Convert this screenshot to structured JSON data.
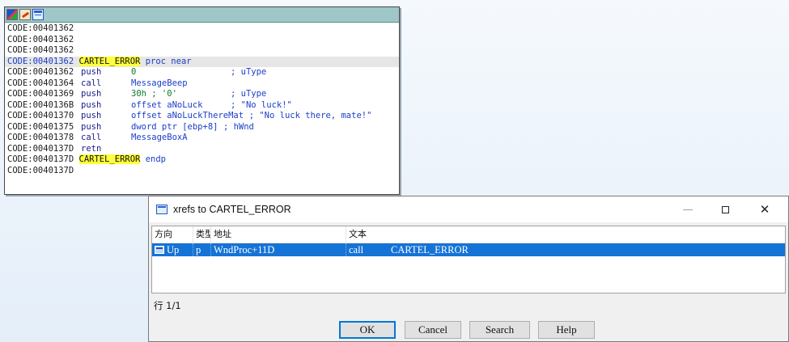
{
  "ida": {
    "lines": [
      {
        "addr": "CODE:00401362",
        "addr_blue": false,
        "sel": false
      },
      {
        "addr": "CODE:00401362",
        "addr_blue": false,
        "sel": false
      },
      {
        "addr": "CODE:00401362",
        "addr_blue": false,
        "sel": false
      },
      {
        "addr": "CODE:00401362",
        "addr_blue": true,
        "sel": true,
        "label": "CARTEL_ERROR",
        "rest": " proc near"
      },
      {
        "addr": "CODE:00401362",
        "mnem": "push",
        "operand": "0",
        "comment": "; uType"
      },
      {
        "addr": "CODE:00401364",
        "mnem": "call",
        "operand": "MessageBeep",
        "comment": ""
      },
      {
        "addr": "CODE:00401369",
        "mnem": "push",
        "operand": "30h ; '0'",
        "comment": "; uType"
      },
      {
        "addr": "CODE:0040136B",
        "mnem": "push",
        "operand": "offset aNoLuck",
        "comment": "; \"No luck!\""
      },
      {
        "addr": "CODE:00401370",
        "mnem": "push",
        "operand": "offset aNoLuckThereMat",
        "comment": "; \"No luck there, mate!\""
      },
      {
        "addr": "CODE:00401375",
        "mnem": "push",
        "operand": "dword ptr [ebp+8]",
        "comment": "; hWnd"
      },
      {
        "addr": "CODE:00401378",
        "mnem": "call",
        "operand": "MessageBoxA",
        "comment": ""
      },
      {
        "addr": "CODE:0040137D",
        "mnem": "retn",
        "operand": "",
        "comment": ""
      },
      {
        "addr": "CODE:0040137D",
        "addr_blue": false,
        "sel": false,
        "label": "CARTEL_ERROR",
        "rest": " endp"
      },
      {
        "addr": "CODE:0040137D",
        "addr_blue": false,
        "sel": false
      }
    ]
  },
  "dialog": {
    "title": "xrefs to CARTEL_ERROR",
    "minimize": "—",
    "close": "✕",
    "columns": [
      "方向",
      "类型",
      "地址",
      "文本"
    ],
    "row": {
      "direction": "Up",
      "type": "p",
      "address": "WndProc+11D",
      "mnemonic": "call",
      "target": "CARTEL_ERROR"
    },
    "status": "行 1/1",
    "buttons": {
      "ok": "OK",
      "cancel": "Cancel",
      "search": "Search",
      "help": "Help"
    }
  },
  "colors": {
    "selection": "#1473d6",
    "highlight": "#ffff3b",
    "toolbar": "#9fc6c8"
  }
}
